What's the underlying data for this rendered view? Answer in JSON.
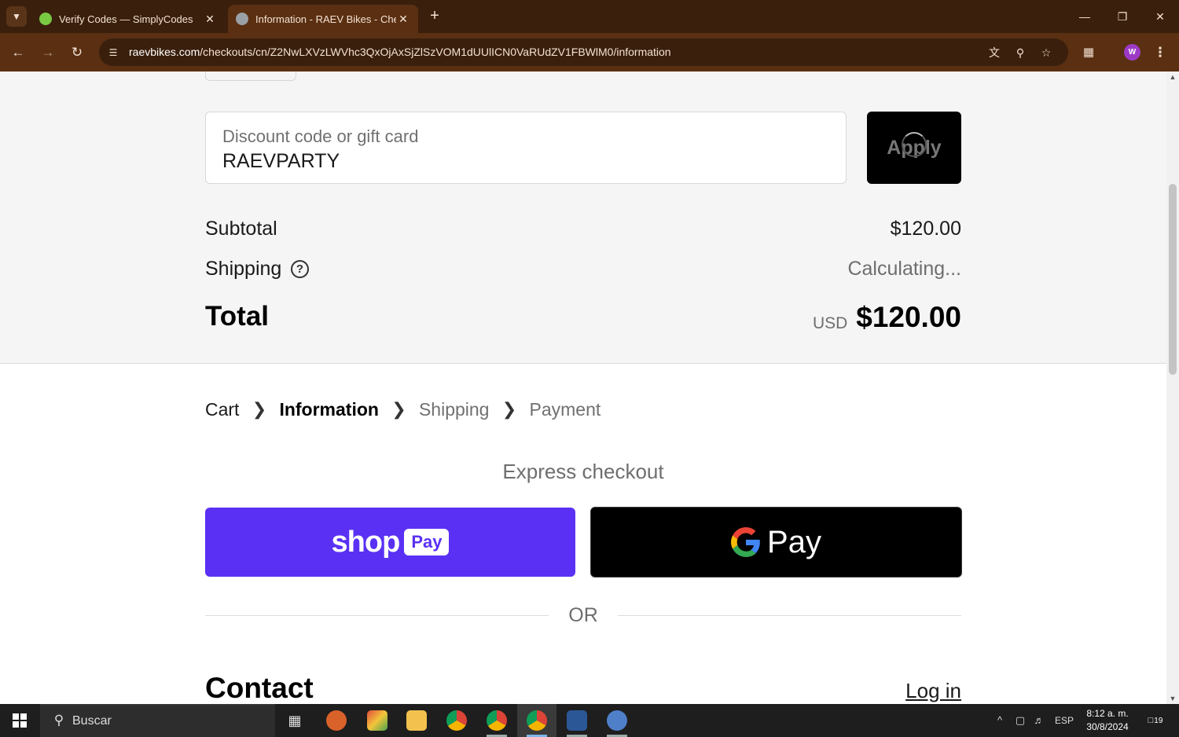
{
  "browser": {
    "tabs": [
      {
        "title": "Verify Codes — SimplyCodes",
        "active": false,
        "favicon_color": "#7ac943"
      },
      {
        "title": "Information - RAEV Bikes - Checkout",
        "active": true,
        "favicon_color": "#9aa0a6"
      }
    ],
    "url_host": "raevbikes.com",
    "url_path": "/checkouts/cn/Z2NwLXVzLWVhc3QxOjAxSjZlSzVOM1dUUlICN0VaRUdZV1FBWlM0/information",
    "profile_initial": "W"
  },
  "discount": {
    "label": "Discount code or gift card",
    "value": "RAEVPARTY",
    "apply_label": "Apply"
  },
  "summary": {
    "subtotal_label": "Subtotal",
    "subtotal_value": "$120.00",
    "shipping_label": "Shipping",
    "shipping_help": "?",
    "shipping_value": "Calculating...",
    "total_label": "Total",
    "total_currency": "USD",
    "total_value": "$120.00"
  },
  "breadcrumb": {
    "cart": "Cart",
    "information": "Information",
    "shipping": "Shipping",
    "payment": "Payment"
  },
  "express": {
    "title": "Express checkout",
    "shop_word": "shop",
    "shop_badge": "Pay",
    "google_pay_word": "Pay",
    "or_label": "OR"
  },
  "contact": {
    "heading": "Contact",
    "login_label": "Log in"
  },
  "taskbar": {
    "search_placeholder": "Buscar",
    "language": "ESP",
    "time": "8:12 a. m.",
    "date": "30/8/2024",
    "notifications": "19"
  },
  "colors": {
    "chrome_dark": "#3a1f0c",
    "chrome_toolbar": "#5a2f12",
    "shop_pay": "#5a31f4",
    "panel": "#f5f5f5"
  }
}
